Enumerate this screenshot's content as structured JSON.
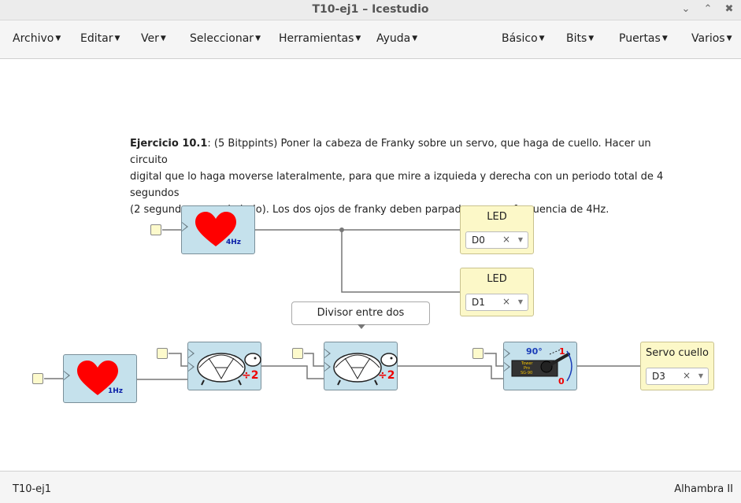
{
  "window": {
    "title": "T10-ej1 – Icestudio"
  },
  "menu": {
    "left": [
      "Archivo",
      "Editar",
      "Ver",
      "Seleccionar",
      "Herramientas",
      "Ayuda"
    ],
    "right": [
      "Básico",
      "Bits",
      "Puertas",
      "Varios"
    ]
  },
  "note": {
    "bold": "Ejercicio 10.1",
    "line1": ": (5 Bitppints) Poner la cabeza de Franky sobre un servo, que haga de cuello. Hacer un circuito",
    "line2": "digital que lo haga moverse lateralmente, para que mire a izquieda y derecha con un periodo total de 4 segundos",
    "line3": "(2 segundos en cada lado). Los dos ojos de franky deben parpadear a una frecuencia de 4Hz."
  },
  "blocks": {
    "heart_4hz": {
      "freq": "4Hz"
    },
    "heart_1hz": {
      "freq": "1Hz"
    },
    "div1": {
      "label": "÷2"
    },
    "div2": {
      "label": "÷2"
    },
    "servo_block": {
      "angle": "90°",
      "one": "1",
      "zero": "0",
      "servo_text_1": "Tower",
      "servo_text_2": "Pro",
      "servo_text_3": "SG-90"
    }
  },
  "tooltip": {
    "text": "Divisor entre dos"
  },
  "outputs": [
    {
      "label": "LED",
      "value": "D0"
    },
    {
      "label": "LED",
      "value": "D1"
    },
    {
      "label": "Servo cuello",
      "value": "D3"
    }
  ],
  "select_clear": "×",
  "status": {
    "left": "T10-ej1",
    "right": "Alhambra II"
  },
  "colors": {
    "heart": "#ff0000",
    "block_bg": "#c5e1ec",
    "io_bg": "#fcf8c8",
    "wire": "#777777"
  }
}
